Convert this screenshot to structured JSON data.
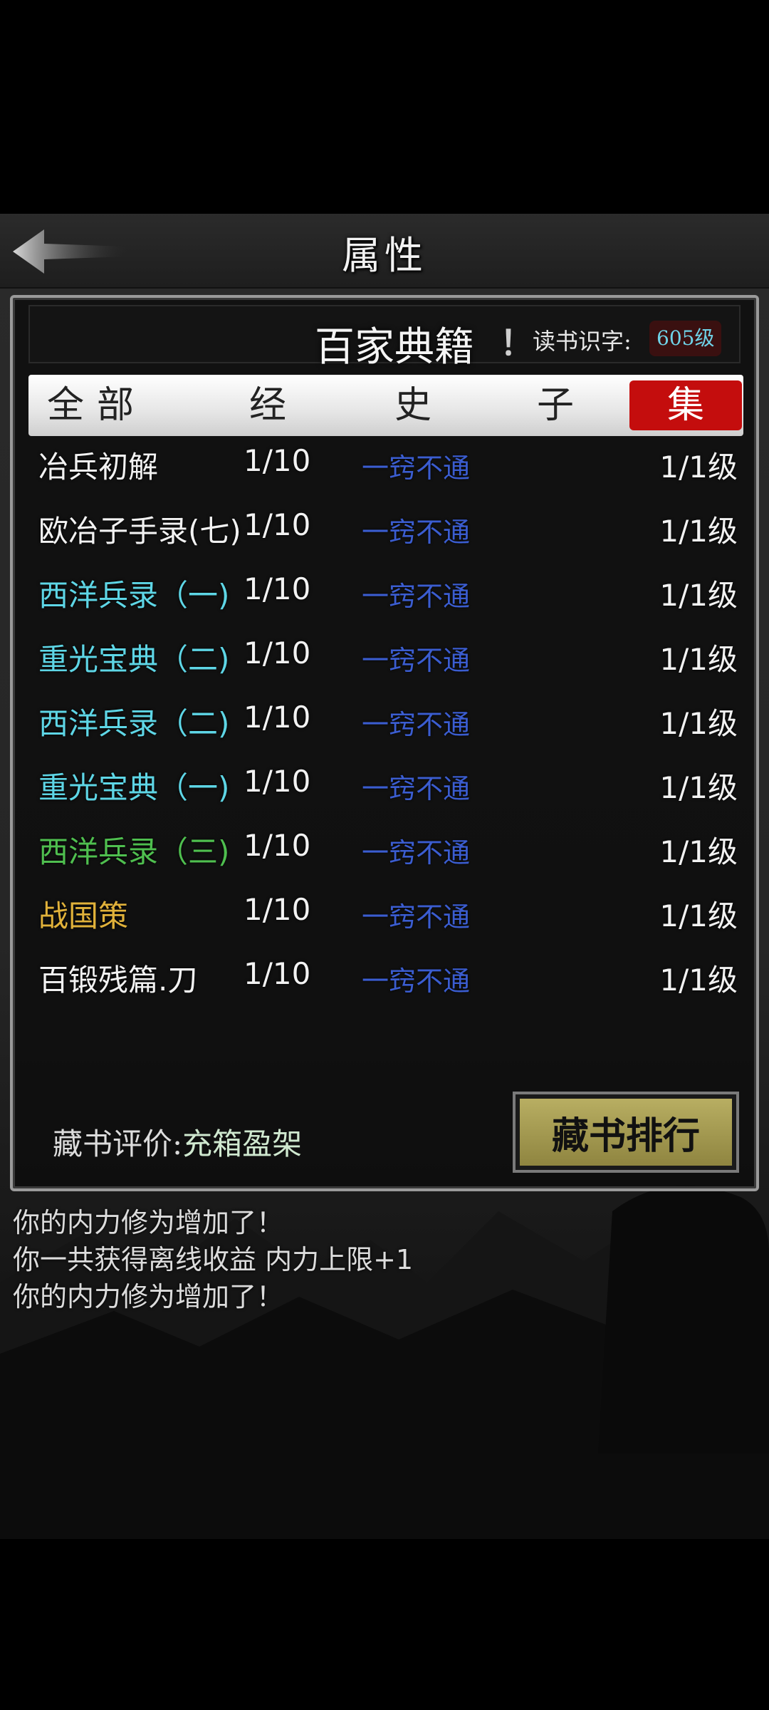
{
  "title": "属性",
  "panel": {
    "title": "百家典籍",
    "info_icon": "！",
    "read_label": "读书识字:",
    "read_level": "605级"
  },
  "tabs": [
    {
      "label": "全部",
      "active": false
    },
    {
      "label": "经",
      "active": false
    },
    {
      "label": "史",
      "active": false
    },
    {
      "label": "子",
      "active": false
    },
    {
      "label": "集",
      "active": true
    }
  ],
  "books": [
    {
      "name": "冶兵初解",
      "color": "#f2f2f2",
      "count": "1/10",
      "mastery": "一窍不通",
      "level": "1/1级"
    },
    {
      "name": "欧冶子手录(七)",
      "color": "#f2f2f2",
      "count": "1/10",
      "mastery": "一窍不通",
      "level": "1/1级"
    },
    {
      "name": "西洋兵录（一)",
      "color": "#5ed6e6",
      "count": "1/10",
      "mastery": "一窍不通",
      "level": "1/1级"
    },
    {
      "name": "重光宝典（二)",
      "color": "#5ed6e6",
      "count": "1/10",
      "mastery": "一窍不通",
      "level": "1/1级"
    },
    {
      "name": "西洋兵录（二)",
      "color": "#5ed6e6",
      "count": "1/10",
      "mastery": "一窍不通",
      "level": "1/1级"
    },
    {
      "name": "重光宝典（一)",
      "color": "#5ed6e6",
      "count": "1/10",
      "mastery": "一窍不通",
      "level": "1/1级"
    },
    {
      "name": "西洋兵录（三)",
      "color": "#4fbf4f",
      "count": "1/10",
      "mastery": "一窍不通",
      "level": "1/1级"
    },
    {
      "name": "战国策",
      "color": "#e0b13a",
      "count": "1/10",
      "mastery": "一窍不通",
      "level": "1/1级"
    },
    {
      "name": "百锻残篇.刀",
      "color": "#f2f2f2",
      "count": "1/10",
      "mastery": "一窍不通",
      "level": "1/1级"
    }
  ],
  "footer": {
    "rating_label": "藏书评价:",
    "rating_value": "充箱盈架",
    "rank_button": "藏书排行"
  },
  "log": [
    "你的内力修为增加了！",
    "你一共获得离线收益 内力上限+1",
    "你的内力修为增加了！"
  ],
  "icons": {
    "back": "back-arrow-icon",
    "info": "info-icon"
  }
}
